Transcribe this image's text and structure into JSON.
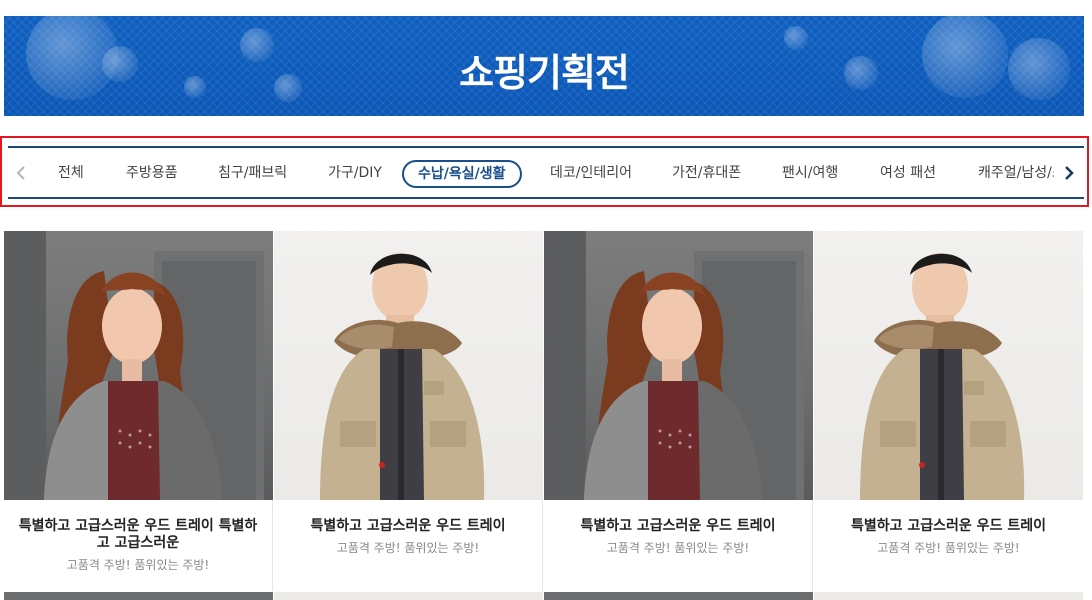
{
  "banner": {
    "title": "쇼핑기획전"
  },
  "nav": {
    "items": [
      {
        "label": "전체"
      },
      {
        "label": "주방용품"
      },
      {
        "label": "침구/패브릭"
      },
      {
        "label": "가구/DIY"
      },
      {
        "label": "수납/욕실/생활",
        "active": true
      },
      {
        "label": "데코/인테리어"
      },
      {
        "label": "가전/휴대폰"
      },
      {
        "label": "팬시/여행"
      },
      {
        "label": "여성 패션"
      },
      {
        "label": "캐주얼/남성/스"
      }
    ],
    "prev_icon": "chevron-left-icon",
    "next_icon": "chevron-right-icon"
  },
  "products": [
    {
      "title": "특별하고 고급스러운 우드 트레이 특별하고 고급스러운",
      "subtitle": "고품격 주방! 품위있는 주방!",
      "photo": "woman-cardigan"
    },
    {
      "title": "특별하고 고급스러운 우드 트레이",
      "subtitle": "고품격 주방! 품위있는 주방!",
      "photo": "man-parka"
    },
    {
      "title": "특별하고 고급스러운 우드 트레이",
      "subtitle": "고품격 주방! 품위있는 주방!",
      "photo": "woman-cardigan"
    },
    {
      "title": "특별하고 고급스러운 우드 트레이",
      "subtitle": "고품격 주방! 품위있는 주방!",
      "photo": "man-parka"
    }
  ],
  "colors": {
    "banner_blue": "#0b5bbb",
    "active_tab": "#1a4f8c",
    "highlight_border": "#e2171f"
  }
}
